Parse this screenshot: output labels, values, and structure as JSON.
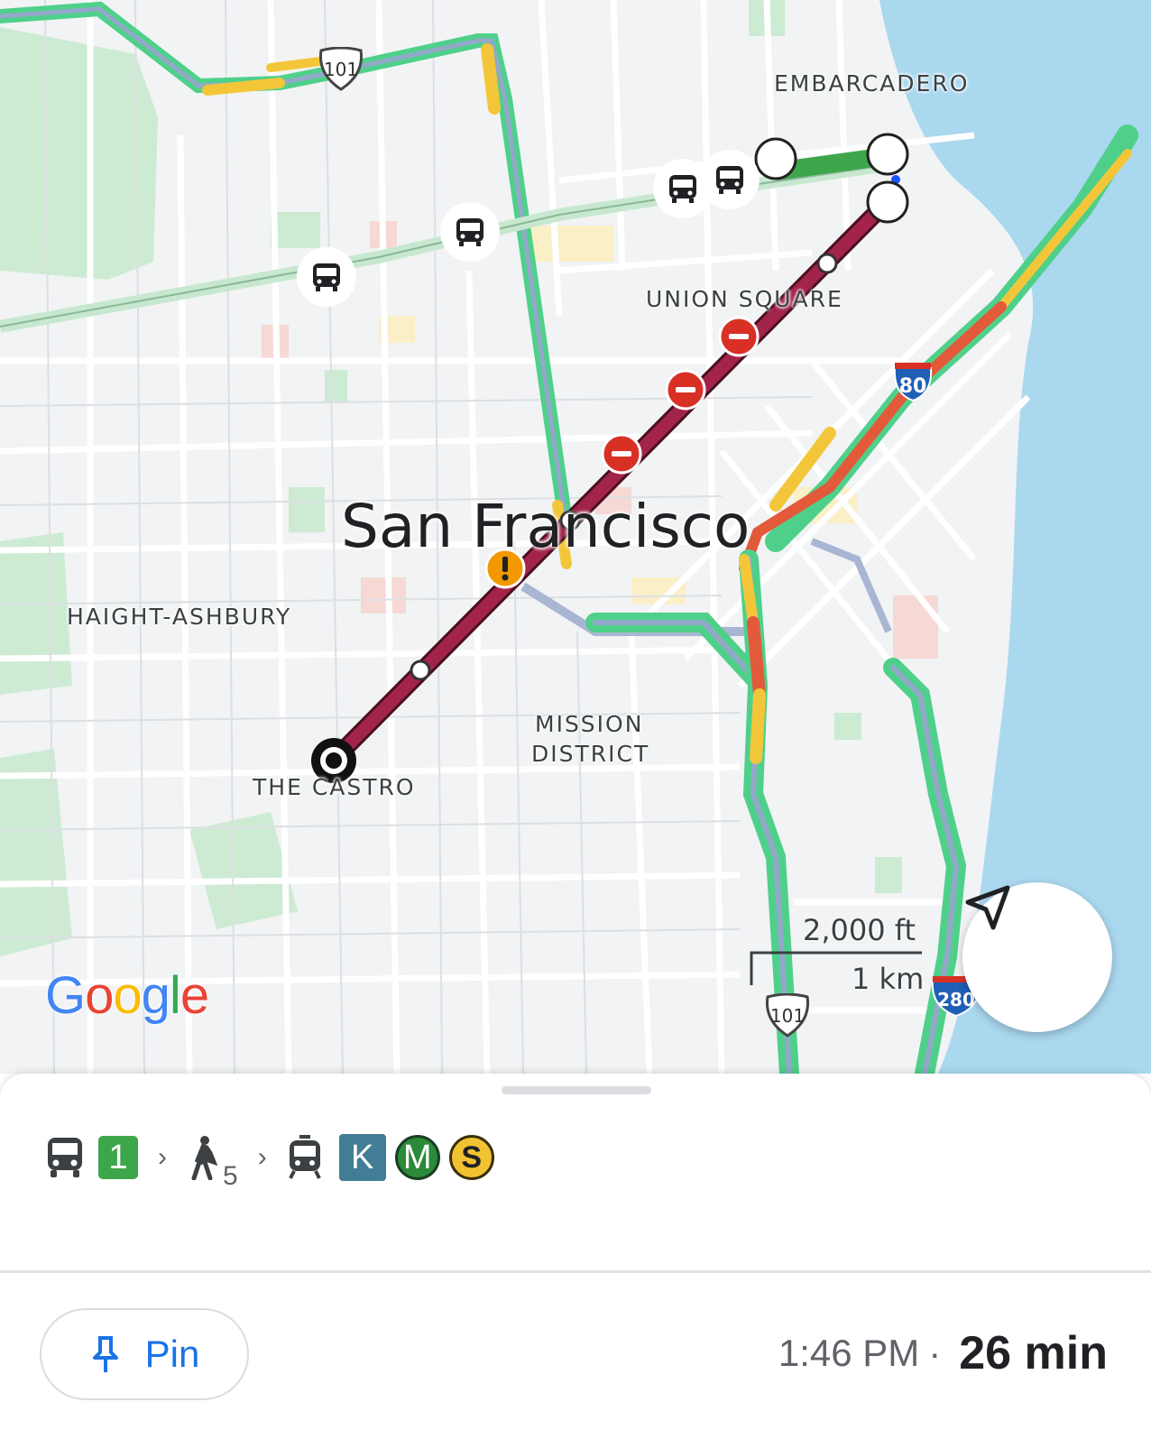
{
  "map": {
    "city_label": "San Francisco",
    "neighborhoods": {
      "embarcadero": "EMBARCADERO",
      "union_square": "UNION SQUARE",
      "haight_ashbury": "HAIGHT-ASHBURY",
      "mission_district_line1": "MISSION",
      "mission_district_line2": "DISTRICT",
      "the_castro": "THE CASTRO"
    },
    "highway_shields": {
      "us101_top": "101",
      "i80": "80",
      "us101_bottom": "101",
      "i280": "280"
    },
    "scale_imperial": "2,000 ft",
    "scale_metric": "1 km",
    "logo_text": "Google",
    "colors": {
      "route_rail": "#a3244a",
      "traffic_green": "#4fd08a",
      "traffic_yellow": "#f3c63a",
      "traffic_red": "#e25a3a",
      "water": "#aad8ef",
      "park": "#cdebd3",
      "alert_red": "#d93025",
      "alert_orange": "#f29900"
    },
    "icons": [
      "bus-stop-icon",
      "no-entry-icon",
      "warning-icon",
      "navigation-arrow-icon",
      "destination-marker-icon"
    ]
  },
  "route_summary": {
    "steps": [
      {
        "type": "bus",
        "icon": "bus-icon",
        "line": "1",
        "color": "#3ea64a"
      },
      {
        "type": "walk",
        "icon": "walk-icon",
        "minutes": "5"
      },
      {
        "type": "tram",
        "icon": "tram-icon",
        "lines": [
          {
            "label": "K",
            "color": "#417d95",
            "shape": "square"
          },
          {
            "label": "M",
            "color": "#2a8a39",
            "shape": "circle"
          },
          {
            "label": "S",
            "color": "#f1c232",
            "shape": "circle"
          }
        ]
      }
    ],
    "pin_label": "Pin",
    "arrival_time": "1:46 PM",
    "separator": "·",
    "duration": "26 min"
  }
}
